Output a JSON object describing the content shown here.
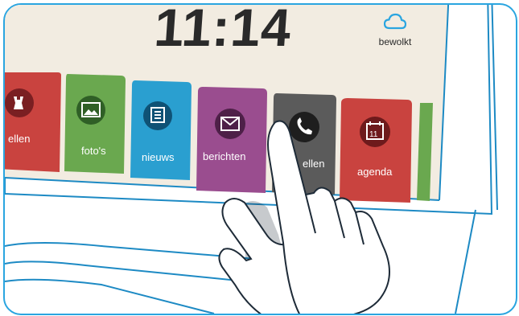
{
  "header": {
    "time": "11:14",
    "weather_label": "bewolkt",
    "weather_icon": "cloud-icon"
  },
  "tiles": [
    {
      "label": "ellen",
      "icon": "chess-icon",
      "color": "#c9433f"
    },
    {
      "label": "foto's",
      "icon": "photo-icon",
      "color": "#6aa84f"
    },
    {
      "label": "nieuws",
      "icon": "newspaper-icon",
      "color": "#2a9fd0"
    },
    {
      "label": "berichten",
      "icon": "mail-icon",
      "color": "#9a4d8f"
    },
    {
      "label": "ellen",
      "icon": "phone-icon",
      "color": "#5b5b5b"
    },
    {
      "label": "agenda",
      "icon": "calendar-icon",
      "date": "11",
      "color": "#c9433f"
    }
  ],
  "colors": {
    "screen_bg": "#f2ece1",
    "bezel_outline": "#2aa5e0",
    "accent": "#2aa5e0"
  }
}
